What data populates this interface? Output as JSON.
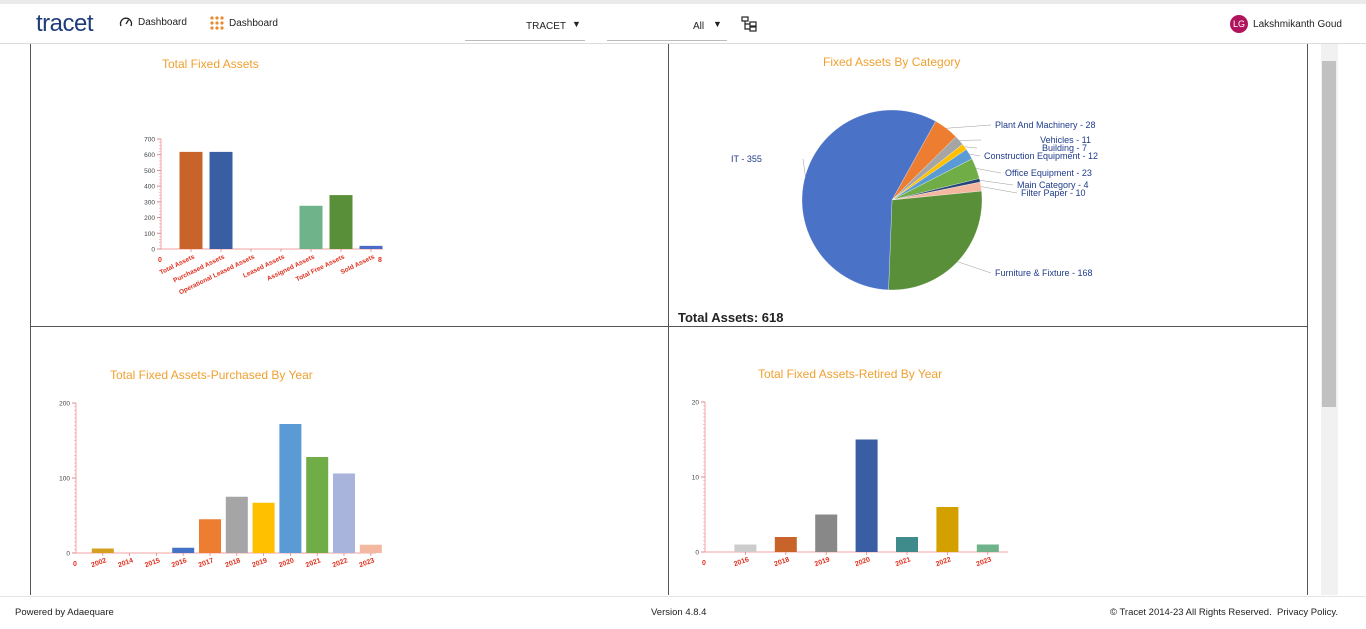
{
  "header": {
    "logo": "tracet",
    "nav1_label": "Dashboard",
    "nav2_label": "Dashboard",
    "org_select": "TRACET",
    "filter_select": "All",
    "user_initials": "LG",
    "user_name": "Lakshmikanth Goud"
  },
  "panels": {
    "total_fixed_assets": {
      "title": "Total Fixed Assets"
    },
    "by_category": {
      "title": "Fixed Assets By Category",
      "total_label": "Total Assets: 618"
    },
    "purchased_by_year": {
      "title": "Total Fixed Assets-Purchased By Year"
    },
    "retired_by_year": {
      "title": "Total Fixed Assets-Retired By Year"
    }
  },
  "footer": {
    "powered": "Powered by Adaequare",
    "version": "Version 4.8.4",
    "copyright": "© Tracet 2014-23 All Rights Reserved.",
    "privacy": "Privacy Policy."
  },
  "chart_data": [
    {
      "type": "bar",
      "title": "Total Fixed Assets",
      "categories": [
        "Total Assets",
        "Purchased Assets",
        "Operational Leased Assets",
        "Leased Assets",
        "Assigned Assets",
        "Total Free Assets",
        "Sold Assets"
      ],
      "values": [
        618,
        618,
        0,
        0,
        275,
        343,
        20
      ],
      "colors": [
        "#c8642a",
        "#3a5ea3",
        "#999999",
        "#cccccc",
        "#6fb38a",
        "#5a8f3a",
        "#4a6cc8"
      ],
      "ylim": [
        0,
        700
      ],
      "yticks": [
        0,
        100,
        200,
        300,
        400,
        500,
        600,
        700
      ],
      "x_min_label": "0",
      "x_max_label": "8"
    },
    {
      "type": "pie",
      "title": "Fixed Assets By Category",
      "slices": [
        {
          "label": "IT - 355",
          "value": 355,
          "color": "#4a73c8"
        },
        {
          "label": "Plant And Machinery - 28",
          "value": 28,
          "color": "#ed7d31"
        },
        {
          "label": "Vehicles - 11",
          "value": 11,
          "color": "#a5a5a5"
        },
        {
          "label": "Building - 7",
          "value": 7,
          "color": "#ffc000"
        },
        {
          "label": "Construction Equipment - 12",
          "value": 12,
          "color": "#5b9bd5"
        },
        {
          "label": "Office Equipment - 23",
          "value": 23,
          "color": "#70ad47"
        },
        {
          "label": "Main Category - 4",
          "value": 4,
          "color": "#264478"
        },
        {
          "label": "Filter Paper - 10",
          "value": 10,
          "color": "#f4b8a0"
        },
        {
          "label": "Furniture & Fixture - 168",
          "value": 168,
          "color": "#5a8f3a"
        }
      ]
    },
    {
      "type": "bar",
      "title": "Total Fixed Assets-Purchased By Year",
      "categories": [
        "2002",
        "2014",
        "2015",
        "2016",
        "2017",
        "2018",
        "2019",
        "2020",
        "2021",
        "2022",
        "2023"
      ],
      "values": [
        6,
        0,
        0,
        7,
        45,
        75,
        67,
        172,
        128,
        106,
        11
      ],
      "colors": [
        "#d4a020",
        "#999999",
        "#cccccc",
        "#4472c4",
        "#ed7d31",
        "#a5a5a5",
        "#ffc000",
        "#5b9bd5",
        "#70ad47",
        "#a9b4dc",
        "#f4b8a0"
      ],
      "ylim": [
        0,
        200
      ],
      "yticks": [
        0,
        100,
        200
      ],
      "x_min_label": "0"
    },
    {
      "type": "bar",
      "title": "Total Fixed Assets-Retired By Year",
      "categories": [
        "2016",
        "2018",
        "2019",
        "2020",
        "2021",
        "2022",
        "2023"
      ],
      "values": [
        1,
        2,
        5,
        15,
        2,
        6,
        1
      ],
      "colors": [
        "#cccccc",
        "#c8642a",
        "#888888",
        "#3a5ea3",
        "#3f8a8a",
        "#d4a000",
        "#6fb38a"
      ],
      "ylim": [
        0,
        20
      ],
      "yticks": [
        0,
        10,
        20
      ],
      "x_min_label": "0"
    }
  ]
}
